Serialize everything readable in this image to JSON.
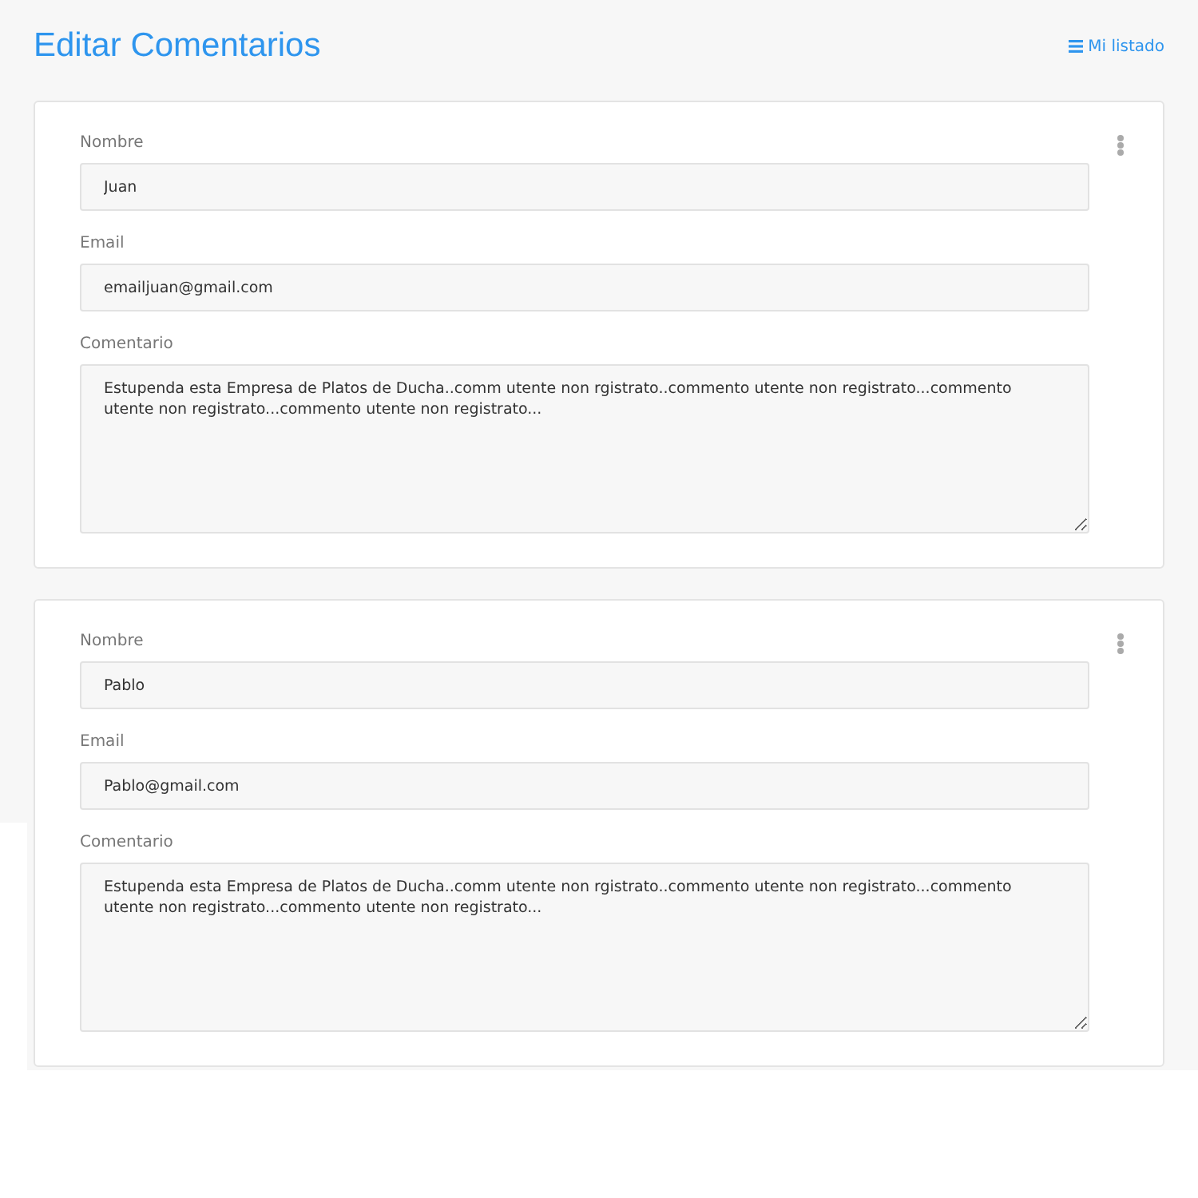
{
  "header": {
    "title": "Editar Comentarios",
    "link": "Mi listado"
  },
  "comments": [
    {
      "fields": [
        {
          "kind": "input",
          "label": "Nombre",
          "value": "Juan"
        },
        {
          "kind": "input",
          "label": "Email",
          "value": "emailjuan@gmail.com"
        },
        {
          "kind": "textarea",
          "label": "Comentario",
          "value": "Estupenda esta Empresa de Platos de Ducha..comm utente non rgistrato..commento utente non registrato...commento utente non registrato...commento utente non registrato..."
        }
      ]
    },
    {
      "fields": [
        {
          "kind": "input",
          "label": "Nombre",
          "value": "Pablo"
        },
        {
          "kind": "input",
          "label": "Email",
          "value": "Pablo@gmail.com"
        },
        {
          "kind": "textarea",
          "label": "Comentario",
          "value": "Estupenda esta Empresa de Platos de Ducha..comm utente non rgistrato..commento utente non registrato...commento utente non registrato...commento utente non registrato..."
        }
      ]
    }
  ]
}
